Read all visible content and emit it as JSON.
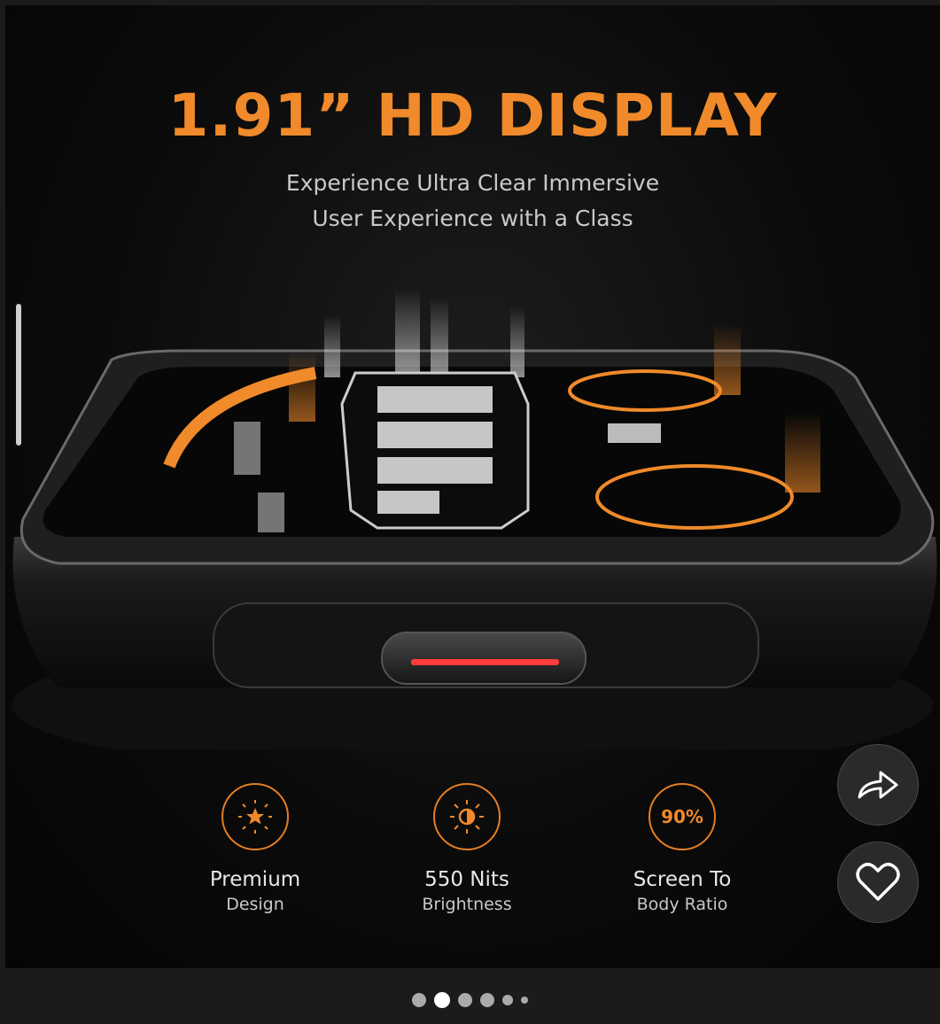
{
  "product_image": {
    "headline": "1.91” HD DISPLAY",
    "subheadline_line1": "Experience Ultra Clear Immersive",
    "subheadline_line2": "User Experience with a Class",
    "features": [
      {
        "icon": "star-sun-icon",
        "title": "Premium",
        "subtitle": "Design"
      },
      {
        "icon": "brightness-icon",
        "title": "550 Nits",
        "subtitle": "Brightness"
      },
      {
        "icon": "percentage-badge-icon",
        "badge": "90%",
        "title": "Screen To",
        "subtitle": "Body Ratio"
      }
    ]
  },
  "actions": {
    "share_icon": "share-arrow-icon",
    "wishlist_icon": "heart-outline-icon"
  },
  "carousel": {
    "total_slides": 6,
    "active_index": 1
  },
  "colors": {
    "accent": "#f08a2a",
    "background": "#0b0b0b",
    "button_red": "#ff3b3b"
  }
}
